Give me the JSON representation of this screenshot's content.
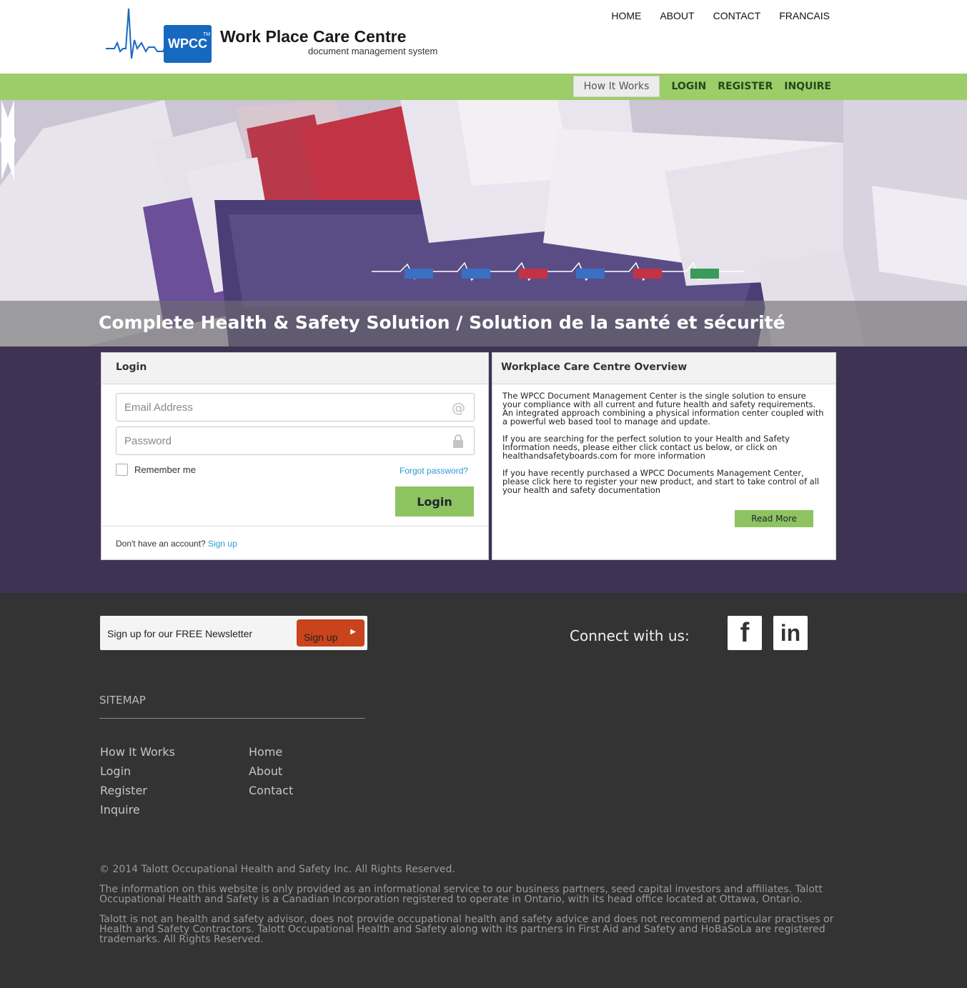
{
  "header": {
    "logo_badge": "WPCC",
    "logo_tm": "TM",
    "logo_title": "Work Place Care Centre",
    "logo_subtitle": "document management system",
    "nav": [
      "HOME",
      "ABOUT",
      "CONTACT",
      "FRANCAIS"
    ]
  },
  "subnav": {
    "how": "How It Works",
    "login": "LOGIN",
    "register": "REGISTER",
    "inquire": "INQUIRE"
  },
  "hero": {
    "caption": "Complete Health & Safety Solution / Solution de la santé et sécurité"
  },
  "login": {
    "title": "Login",
    "email_placeholder": "Email Address",
    "password_placeholder": "Password",
    "remember": "Remember me",
    "forgot": "Forgot password?",
    "button": "Login",
    "no_account": "Don't have an account?",
    "signup": "Sign up"
  },
  "overview": {
    "title": "Workplace Care Centre Overview",
    "p1": "The WPCC Document Management Center is the single solution to ensure your compliance with all current and future health and safety requirements. An integrated approach combining a physical information center coupled with a powerful web based tool to manage and update.",
    "p2": "If you are searching for the perfect solution to your Health and Safety Information needs, please either click contact us below, or click on healthandsafetyboards.com for more information",
    "p3": "If you have recently purchased a WPCC Documents Management Center, please click here to register your new product, and start to take control of all your health and safety documentation",
    "read_more": "Read More"
  },
  "footer": {
    "newsletter": "Sign up for our FREE Newsletter",
    "newsletter_button": "Sign up",
    "connect": "Connect with us:",
    "facebook_icon": "f",
    "linkedin_icon": "in",
    "sitemap_title": "SITEMAP",
    "sitemap_col1": [
      "How It Works",
      "Login",
      "Register",
      "Inquire"
    ],
    "sitemap_col2": [
      "Home",
      "About",
      "Contact"
    ],
    "copyright": "© 2014 Talott Occupational Health and Safety Inc. All Rights Reserved.",
    "info1": "The information on this website is only provided as an informational service to our business partners, seed capital investors and affiliates. Talott Occupational Health and Safety is a Canadian Incorporation registered to operate in Ontario, with its head office located at Ottawa, Ontario.",
    "info2": "Talott is not an health and safety advisor, does not provide occupational health and safety advice and does not recommend particular practises or Health and Safety Contractors. Talott Occupational Health and Safety along with its partners in First Aid and Safety and HoBaSoLa are registered trademarks. All Rights Reserved."
  },
  "colors": {
    "green_bar": "#9ccd68",
    "button_green": "#8dc461",
    "purple_band": "#3f3354",
    "footer": "#333333",
    "signup_orange": "#c9431c",
    "link_blue": "#2a9ad6",
    "logo_blue": "#1769c0"
  }
}
